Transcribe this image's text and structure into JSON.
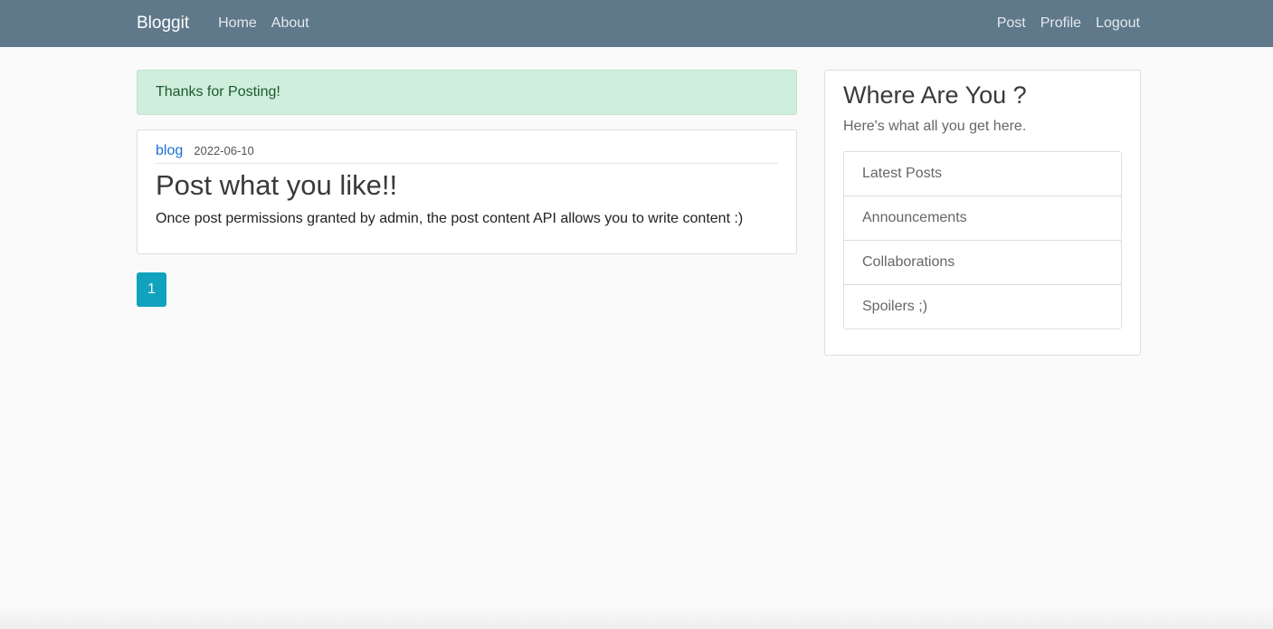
{
  "navbar": {
    "brand": "Bloggit",
    "left_links": [
      "Home",
      "About"
    ],
    "right_links": [
      "Post",
      "Profile",
      "Logout"
    ]
  },
  "alert": {
    "message": "Thanks for Posting!"
  },
  "post": {
    "category": "blog",
    "date": "2022-06-10",
    "title": "Post what you like!!",
    "content": "Once post permissions granted by admin, the post content API allows you to write content :)"
  },
  "pagination": {
    "current_page": "1"
  },
  "sidebar": {
    "title": "Where Are You ?",
    "subtitle": "Here's what all you get here.",
    "items": [
      "Latest Posts",
      "Announcements",
      "Collaborations",
      "Spoilers ;)"
    ]
  },
  "colors": {
    "navbar_bg": "#5f788a",
    "alert_bg": "#d0eedc",
    "alert_text": "#1b5a2c",
    "link_blue": "#1c6fd8",
    "page_button_bg": "#11a3bd"
  }
}
